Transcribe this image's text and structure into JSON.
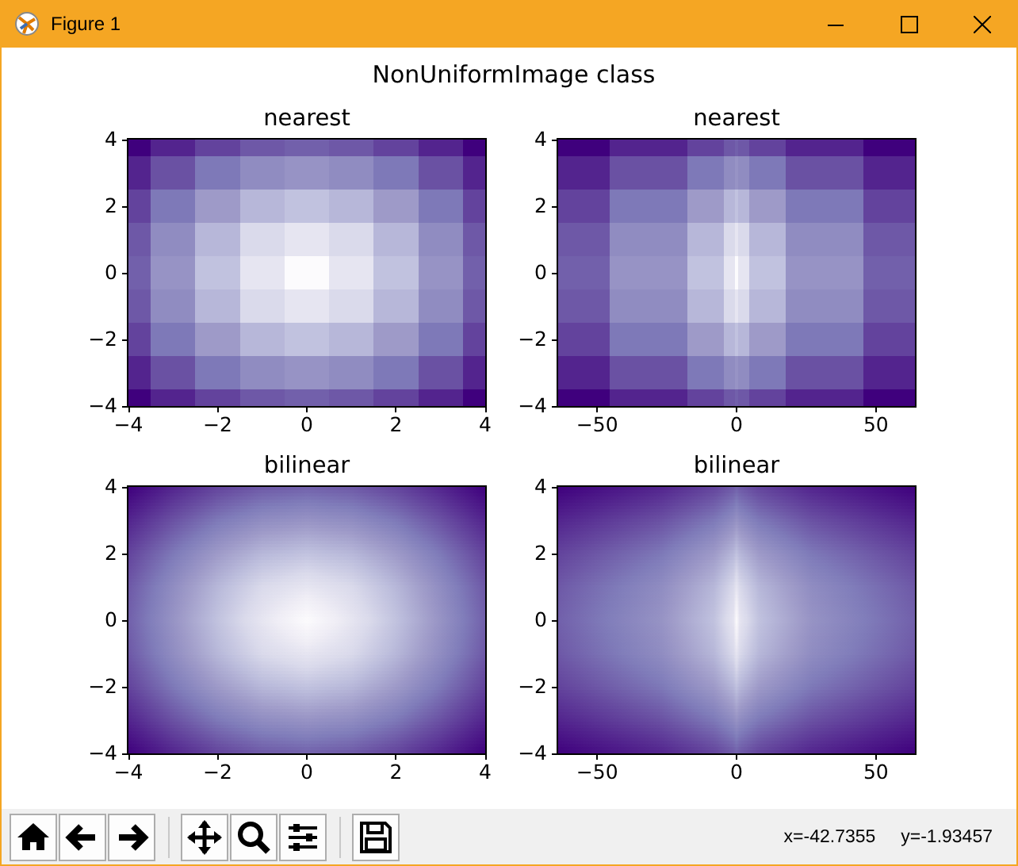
{
  "window": {
    "title": "Figure 1"
  },
  "figure": {
    "title": "NonUniformImage class",
    "subplots": [
      {
        "title": "nearest",
        "kind": "stepped",
        "xticks": [
          "−4",
          "−2",
          "0",
          "2",
          "4"
        ],
        "yticks": [
          "4",
          "2",
          "0",
          "−2",
          "−4"
        ]
      },
      {
        "title": "nearest",
        "kind": "stepped",
        "xticks": [
          "−50",
          "0",
          "50"
        ],
        "yticks": [
          "4",
          "2",
          "0",
          "−2",
          "−4"
        ]
      },
      {
        "title": "bilinear",
        "kind": "smooth",
        "xticks": [
          "−4",
          "−2",
          "0",
          "2",
          "4"
        ],
        "yticks": [
          "4",
          "2",
          "0",
          "−2",
          "−4"
        ]
      },
      {
        "title": "bilinear",
        "kind": "smooth",
        "xticks": [
          "−50",
          "0",
          "50"
        ],
        "yticks": [
          "4",
          "2",
          "0",
          "−2",
          "−4"
        ]
      }
    ]
  },
  "toolbar": {
    "status": "x=-42.7355     y=-1.93457"
  }
}
